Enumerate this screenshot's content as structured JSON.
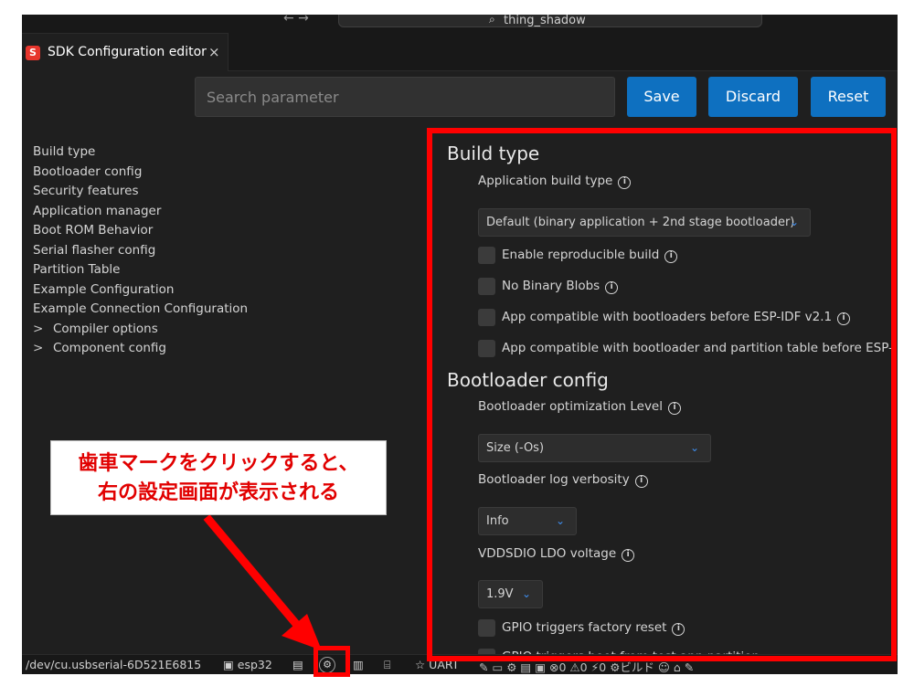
{
  "titlebar": {
    "nav": "← →",
    "command_center": "thing_shadow"
  },
  "tab": {
    "icon_letter": "S",
    "label": "SDK Configuration editor",
    "close": "×"
  },
  "search": {
    "placeholder": "Search parameter",
    "value": ""
  },
  "buttons": {
    "save": "Save",
    "discard": "Discard",
    "reset": "Reset"
  },
  "menu": {
    "items": [
      "Build type",
      "Bootloader config",
      "Security features",
      "Application manager",
      "Boot ROM Behavior",
      "Serial flasher config",
      "Partition Table",
      "Example Configuration",
      "Example Connection Configuration"
    ],
    "expandable": [
      "Compiler options",
      "Component config"
    ],
    "chevron": ">"
  },
  "content": {
    "build_type": {
      "title": "Build type",
      "app_build_type_label": "Application build type",
      "app_build_type_value": "Default (binary application + 2nd stage bootloader)",
      "checks": [
        "Enable reproducible build",
        "No Binary Blobs",
        "App compatible with bootloaders before ESP-IDF v2.1",
        "App compatible with bootloader and partition table before ESP-IDF"
      ]
    },
    "bootloader_config": {
      "title": "Bootloader config",
      "opt_level_label": "Bootloader optimization Level",
      "opt_level_value": "Size (-Os)",
      "log_label": "Bootloader log verbosity",
      "log_value": "Info",
      "vdd_label": "VDDSDIO LDO voltage",
      "vdd_value": "1.9V",
      "gpio_check": "GPIO triggers factory reset",
      "gpio_check2": "GPIO triggers boot from test app partition"
    },
    "info_glyph": "i",
    "caret_glyph": "⌄"
  },
  "statusbar": {
    "port": "/dev/cu.usbserial-6D521E6815",
    "chip": "esp32",
    "uart": "☆ UART",
    "rest": "✎  ▭  ⚙  ▤  ▣  ⊗0 ⚠0  ⚡0  ⚙ビルド  ☺  ⌂  ✎"
  },
  "annotation": {
    "line1": "歯車マークをクリックすると、",
    "line2": "右の設定画面が表示される",
    "highlight_color": "#ff0000"
  },
  "colors": {
    "accent": "#0e70c0",
    "background": "#1f1f1f",
    "highlight": "#ff0000"
  }
}
